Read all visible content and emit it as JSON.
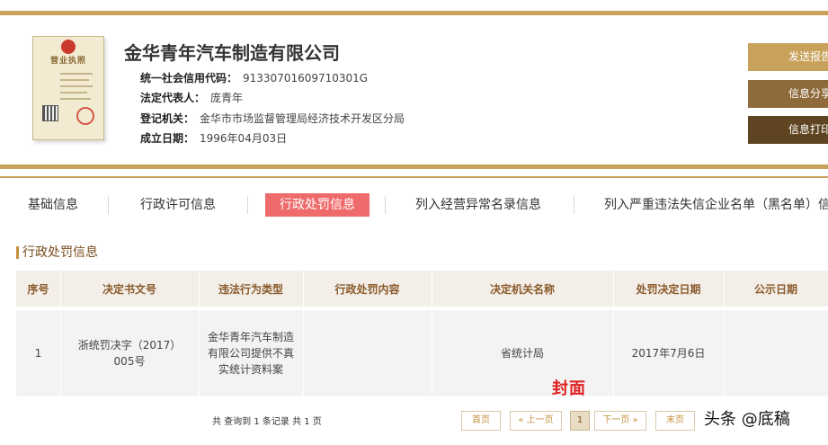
{
  "license": {
    "title": "营业执照"
  },
  "company": {
    "name": "金华青年汽车制造有限公司",
    "credit_code_label": "统一社会信用代码：",
    "credit_code": "91330701609710301G",
    "legal_rep_label": "法定代表人：",
    "legal_rep": "庞青年",
    "registry_label": "登记机关：",
    "registry": "金华市市场监督管理局经济技术开发区分局",
    "founded_label": "成立日期：",
    "founded": "1996年04月03日"
  },
  "side_buttons": [
    "发送报告",
    "信息分享",
    "信息打印"
  ],
  "tabs": [
    "基础信息",
    "行政许可信息",
    "行政处罚信息",
    "列入经营异常名录信息",
    "列入严重违法失信企业名单（黑名单）信"
  ],
  "active_tab": "行政处罚信息",
  "section": {
    "title": "行政处罚信息"
  },
  "table": {
    "headers": [
      "序号",
      "决定书文号",
      "违法行为类型",
      "行政处罚内容",
      "决定机关名称",
      "处罚决定日期",
      "公示日期"
    ],
    "rows": [
      [
        "1",
        "浙统罚决字（2017）005号",
        "金华青年汽车制造有限公司提供不真实统计资料案",
        "",
        "省统计局",
        "2017年7月6日",
        ""
      ]
    ]
  },
  "watermark": "封面",
  "pagination": {
    "summary": "共 查询到 1 条记录 共 1 页",
    "first": "首页",
    "prev": "« 上一页",
    "current": "1",
    "next": "下一页 »",
    "last": "末页"
  },
  "byline": "头条 @底稿",
  "colors": {
    "gold": "#c8a15a",
    "brown": "#8f6a3a",
    "dark_brown": "#5e4420",
    "active_tab": "#ef6b6b",
    "header_text": "#8a5a2b"
  }
}
